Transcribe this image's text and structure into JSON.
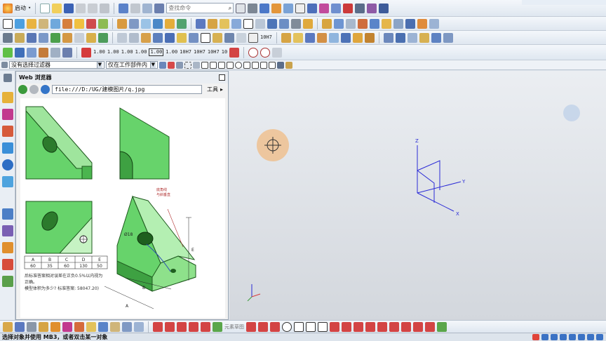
{
  "toolbar": {
    "start_label": "启动",
    "search_placeholder": "查找命令",
    "dim_labels": [
      "1.00",
      "1.00",
      "1.00",
      "1.00",
      "1.00",
      "1.00",
      "10H7",
      "10H7",
      "10H7",
      "10"
    ]
  },
  "filterbar": {
    "filter_value": "没有选择过滤器",
    "scope_value": "仅在工作部件内"
  },
  "browser": {
    "title": "Web 浏览器",
    "url": "file:///D:/UG/建模图片/q.jpg",
    "tools_label": "工具"
  },
  "drawing": {
    "annotation_top": "底角线",
    "annotation_bottom": "与斜垂直",
    "dia_label": "Ø18",
    "table_headers": [
      "A",
      "B",
      "C",
      "D",
      "E"
    ],
    "table_values": [
      "60",
      "35",
      "60",
      "130",
      "50"
    ],
    "note_line1": "后标准答案相对误差在正负0.5%以内视为",
    "note_line2": "正确。",
    "note_line3": "模型体积为多少? 标准答案: 58047.20)"
  },
  "triad": {
    "x": "X",
    "y": "Y",
    "z": "Z"
  },
  "bottombar": {
    "style_label": "元素草图"
  },
  "status": {
    "prompt": "选择对象并使用 MB3，或者双击某一对象"
  },
  "colors": {
    "part_green": "#67d36b",
    "part_green_light": "#b4efb2",
    "axis_blue": "#2a2ad6",
    "highlight_orange": "#f3b16a"
  }
}
